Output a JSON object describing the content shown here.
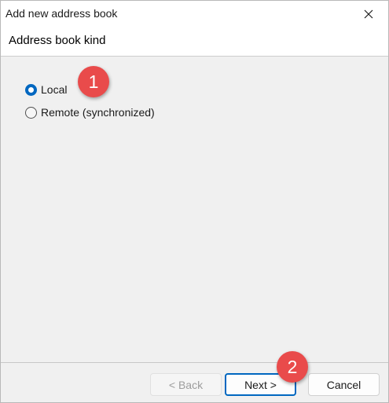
{
  "window": {
    "title": "Add new address book",
    "close_icon": "close-icon"
  },
  "header": {
    "title": "Address book kind"
  },
  "options": [
    {
      "label": "Local",
      "checked": true
    },
    {
      "label": "Remote (synchronized)",
      "checked": false
    }
  ],
  "buttons": {
    "back_label": "< Back",
    "next_label": "Next >",
    "cancel_label": "Cancel"
  },
  "badges": {
    "one": "1",
    "two": "2"
  },
  "colors": {
    "accent": "#0067c0",
    "badge": "#e94b4b"
  }
}
